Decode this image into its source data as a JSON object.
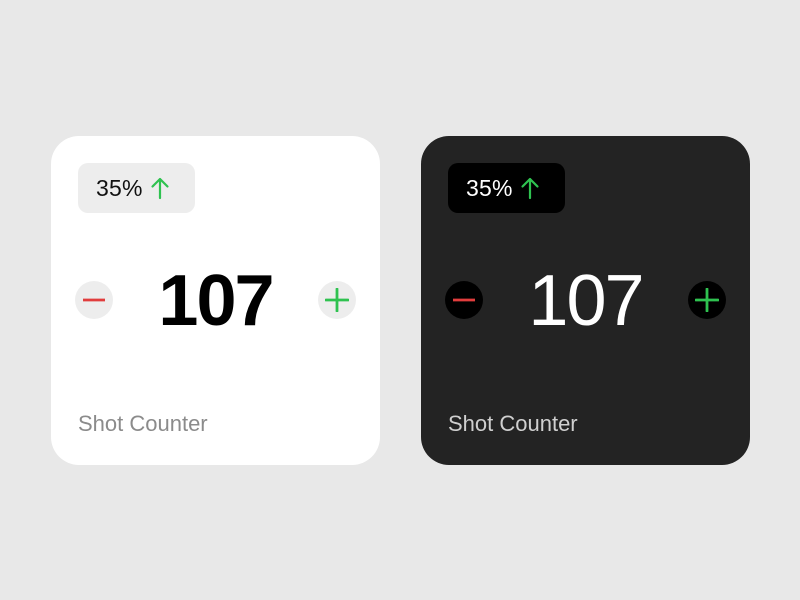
{
  "colors": {
    "background": "#e8e8e8",
    "light_card": "#ffffff",
    "dark_card": "#232323",
    "increase_green": "#2fc250",
    "decrease_red": "#e13d3d"
  },
  "widgets": [
    {
      "theme": "light",
      "badge": {
        "percent": "35%",
        "trend_icon": "arrow-up-icon"
      },
      "count": "107",
      "decrement_icon": "minus-icon",
      "increment_icon": "plus-icon",
      "title": "Shot Counter"
    },
    {
      "theme": "dark",
      "badge": {
        "percent": "35%",
        "trend_icon": "arrow-up-icon"
      },
      "count": "107",
      "decrement_icon": "minus-icon",
      "increment_icon": "plus-icon",
      "title": "Shot Counter"
    }
  ]
}
